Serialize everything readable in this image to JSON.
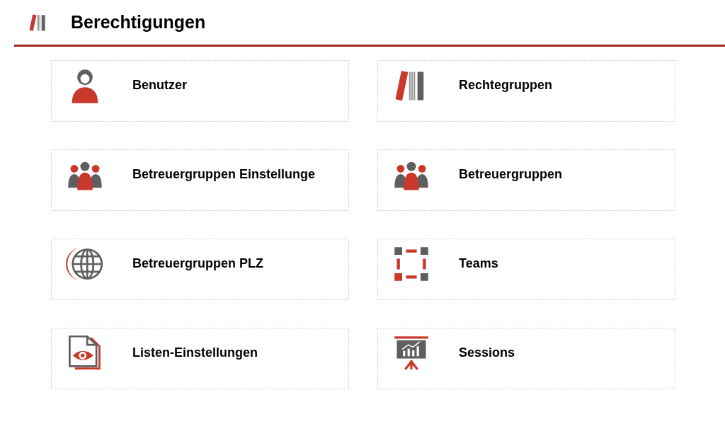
{
  "header": {
    "title": "Berechtigungen"
  },
  "tiles": [
    {
      "label": "Benutzer"
    },
    {
      "label": "Rechtegruppen"
    },
    {
      "label": "Betreuergruppen Einstellunge"
    },
    {
      "label": "Betreuergruppen"
    },
    {
      "label": "Betreuergruppen PLZ"
    },
    {
      "label": "Teams"
    },
    {
      "label": "Listen-Einstellungen"
    },
    {
      "label": "Sessions"
    }
  ]
}
